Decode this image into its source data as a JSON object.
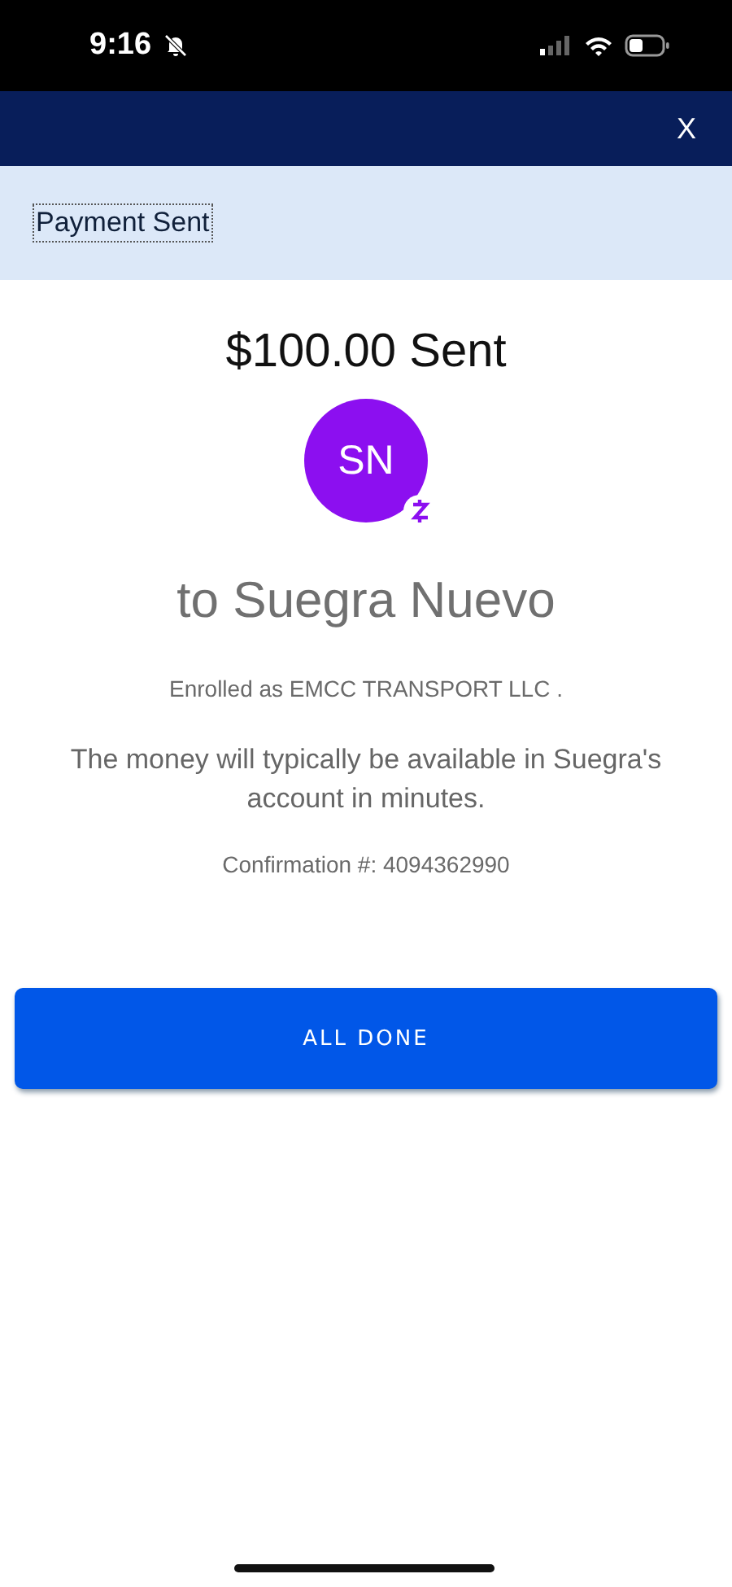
{
  "status_bar": {
    "time": "9:16",
    "silent": true
  },
  "header": {
    "close": "X"
  },
  "banner": {
    "title": "Payment Sent"
  },
  "amount": "$100.00 Sent",
  "avatar": {
    "initials": "SN",
    "color": "#8c0ff0"
  },
  "recipient": "to Suegra Nuevo",
  "enrolled": "Enrolled as EMCC TRANSPORT LLC .",
  "message": "The money will typically be available in Suegra's account in minutes.",
  "confirmation": "Confirmation #: 4094362990",
  "button": "ALL DONE"
}
